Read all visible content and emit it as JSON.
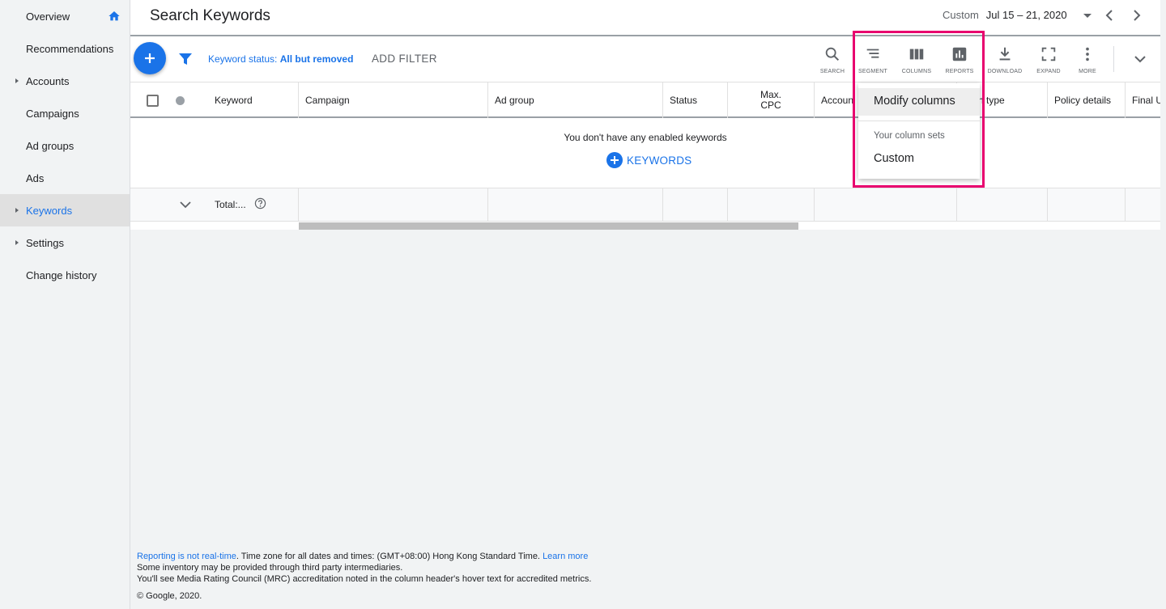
{
  "sidebar": {
    "items": [
      {
        "label": "Overview"
      },
      {
        "label": "Recommendations"
      },
      {
        "label": "Accounts"
      },
      {
        "label": "Campaigns"
      },
      {
        "label": "Ad groups"
      },
      {
        "label": "Ads"
      },
      {
        "label": "Keywords"
      },
      {
        "label": "Settings"
      },
      {
        "label": "Change history"
      }
    ]
  },
  "header": {
    "title": "Search Keywords",
    "date_label": "Custom",
    "date_value": "Jul 15 – 21, 2020"
  },
  "toolbar": {
    "filter_prefix": "Keyword status:",
    "filter_value": "All but removed",
    "add_filter": "ADD FILTER",
    "tools": [
      "SEARCH",
      "SEGMENT",
      "COLUMNS",
      "REPORTS",
      "DOWNLOAD",
      "EXPAND",
      "MORE"
    ]
  },
  "table": {
    "columns": [
      "Keyword",
      "Campaign",
      "Ad group",
      "Status",
      "Max.",
      "CPC",
      "Accoun",
      "h type",
      "Policy details",
      "Final U"
    ],
    "empty_message": "You don't have any enabled keywords",
    "add_keywords": "KEYWORDS",
    "total_label": "Total:..."
  },
  "menu": {
    "modify": "Modify columns",
    "section": "Your column sets",
    "custom": "Custom"
  },
  "footer": {
    "line1_link": "Reporting is not real-time",
    "line1_text": ". Time zone for all dates and times: (GMT+08:00) Hong Kong Standard Time.",
    "line1_learn": "Learn more",
    "line2": "Some inventory may be provided through third party intermediaries.",
    "line3": "You'll see Media Rating Council (MRC) accreditation noted in the column header's hover text for accredited metrics.",
    "copyright": "© Google, 2020."
  },
  "colors": {
    "accent": "#1a73e8",
    "highlight": "#e8006e"
  }
}
